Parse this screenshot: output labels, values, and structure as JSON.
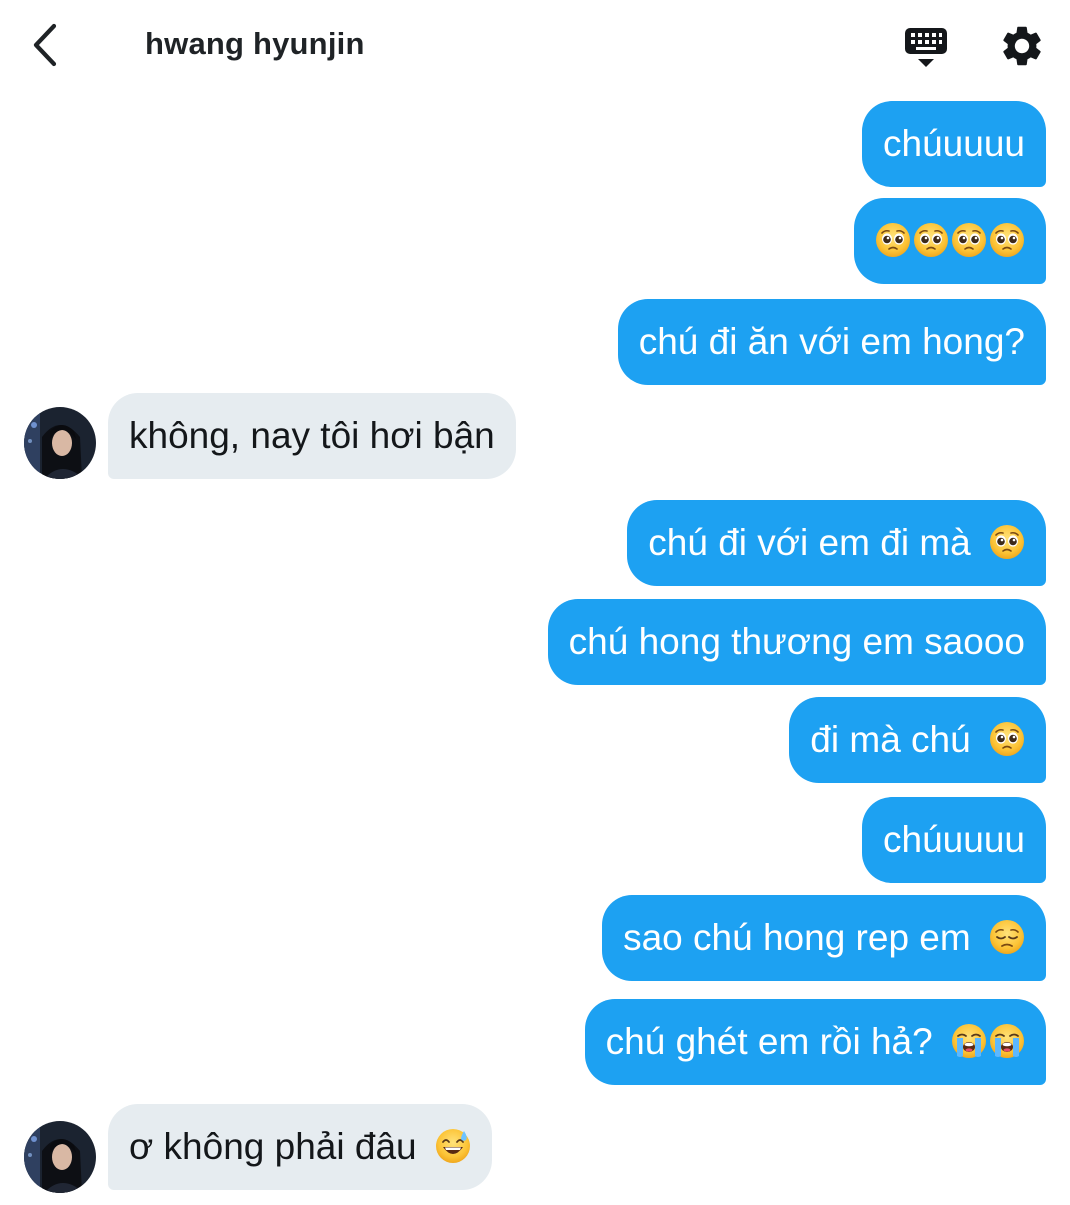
{
  "header": {
    "contact_name": "hwang hyunjin"
  },
  "icons": {
    "back": "chevron-left-icon",
    "keyboard": "keyboard-icon",
    "settings": "gear-icon",
    "pleading_face": "🥺",
    "pensive_face": "😔",
    "loudly_crying_face": "😭",
    "grinning_sweat": "😅"
  },
  "colors": {
    "outgoing_bubble": "#1da1f2",
    "incoming_bubble": "#e6ecf0"
  },
  "messages": [
    {
      "sender": "me",
      "text": "chúuuuu"
    },
    {
      "sender": "me",
      "text": "",
      "emojis": [
        "🥺",
        "🥺",
        "🥺",
        "🥺"
      ]
    },
    {
      "sender": "me",
      "text": "chú đi ăn với em hong?"
    },
    {
      "sender": "hwang hyunjin",
      "text": "không, nay tôi hơi bận"
    },
    {
      "sender": "me",
      "text": "chú đi với em đi mà",
      "emojis": [
        "🥺"
      ]
    },
    {
      "sender": "me",
      "text": "chú hong thương em saooo"
    },
    {
      "sender": "me",
      "text": "đi mà chú",
      "emojis": [
        "🥺"
      ]
    },
    {
      "sender": "me",
      "text": "chúuuuu"
    },
    {
      "sender": "me",
      "text": "sao chú hong rep em",
      "emojis": [
        "😔"
      ]
    },
    {
      "sender": "me",
      "text": "chú ghét em rồi hả?",
      "emojis": [
        "😭",
        "😭"
      ]
    },
    {
      "sender": "hwang hyunjin",
      "text": "ơ không phải đâu",
      "emojis": [
        "😅"
      ]
    }
  ]
}
